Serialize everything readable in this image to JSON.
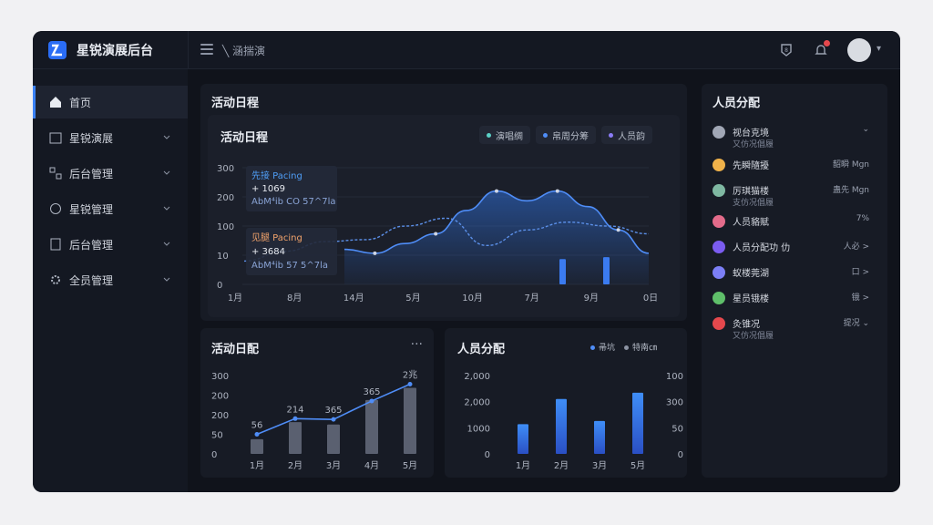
{
  "app": {
    "title": "星锐演展后台"
  },
  "header": {
    "tab": "╲ 涵揣演"
  },
  "sidebar": {
    "items": [
      {
        "label": "首页",
        "icon": "home-icon",
        "active": true
      },
      {
        "label": "星锐演展",
        "icon": "calendar-icon"
      },
      {
        "label": "后台管理",
        "icon": "grid-icon"
      },
      {
        "label": "星锐管理",
        "icon": "clock-icon"
      },
      {
        "label": "后台管理",
        "icon": "file-icon"
      },
      {
        "label": "全员管理",
        "icon": "gear-icon"
      }
    ]
  },
  "main": {
    "schedule_title": "活动日程",
    "inner_title": "活动日程",
    "legend": [
      "演唱绸",
      "帛周分筹",
      "人员韵"
    ],
    "legend_colors": [
      "#5bd0c6",
      "#4f8df7",
      "#8b7cf6"
    ],
    "annotations": [
      {
        "title": "先接 Pacing",
        "value": "+ 1069",
        "note": "AbM⁴ib CO 57^7la",
        "color": "#4f9ef7"
      },
      {
        "title": "见腿 Pacing",
        "value": "+ 3684",
        "note": "AbM⁴ib 57 5^7la",
        "color": "#f2a36b"
      }
    ]
  },
  "chart_data": [
    {
      "type": "area",
      "title": "活动日程",
      "y_ticks": [
        "300",
        "200",
        "100",
        "10",
        "0"
      ],
      "x_ticks": [
        "1月",
        "8月",
        "14月",
        "5月",
        "10月",
        "7月",
        "9月",
        "0日"
      ],
      "series": [
        {
          "values": [
            90,
            80,
            105,
            130,
            190,
            240,
            215,
            240,
            200,
            140,
            80
          ]
        },
        {
          "values": [
            60,
            85,
            110,
            115,
            150,
            170,
            100,
            140,
            160,
            150,
            130
          ]
        },
        {
          "values": [
            0,
            0,
            0,
            0,
            0,
            0,
            0,
            0,
            0,
            65,
            70
          ]
        }
      ],
      "ylim": [
        0,
        300
      ]
    },
    {
      "type": "bar",
      "title": "活动日配",
      "categories": [
        "1月",
        "2月",
        "3月",
        "4月",
        "5月"
      ],
      "y_ticks": [
        "300",
        "200",
        "200",
        "50",
        "0"
      ],
      "bars": [
        30,
        65,
        60,
        110,
        135
      ],
      "line": [
        50,
        90,
        88,
        135,
        178
      ],
      "line_labels": [
        "56",
        "214",
        "365",
        "365",
        "2兆"
      ]
    },
    {
      "type": "bar",
      "title": "人员分配",
      "legend": [
        "帚坑",
        "特南㎝"
      ],
      "categories": [
        "1月",
        "2月",
        "3月",
        "5月"
      ],
      "y_ticks_left": [
        "2,000",
        "2,000",
        "1000",
        "0"
      ],
      "y_ticks_right": [
        "100",
        "300",
        "50",
        "0"
      ],
      "values": [
        38,
        70,
        42,
        78
      ]
    }
  ],
  "people": {
    "title": "人员分配",
    "items": [
      {
        "label": "视台克境",
        "sub": "又仿况倡履",
        "value": "⌄",
        "color": "#a1a7b5"
      },
      {
        "label": "先瞬隨擾",
        "sub": "",
        "value": "韶瞬 Mgn",
        "color": "#f0b24a"
      },
      {
        "label": "厉琪猫楼",
        "sub": "支仿况倡履",
        "value": "蛊先 Mgn",
        "color": "#7fb8a2"
      },
      {
        "label": "人员貉赋",
        "sub": "",
        "value": "7%",
        "color": "#e36b8a"
      },
      {
        "label": "人员分配功 仂",
        "sub": "",
        "value": "人必 >",
        "color": "#7b5cf0"
      },
      {
        "label": "蚁楼莞湖",
        "sub": "",
        "value": "口 >",
        "color": "#7c7ff6"
      },
      {
        "label": "星员锇楼",
        "sub": "",
        "value": "锇 >",
        "color": "#5fbf6a"
      },
      {
        "label": "灸锥况",
        "sub": "又仿况倡履",
        "value": "提况 ⌄",
        "color": "#e5484d"
      }
    ]
  }
}
